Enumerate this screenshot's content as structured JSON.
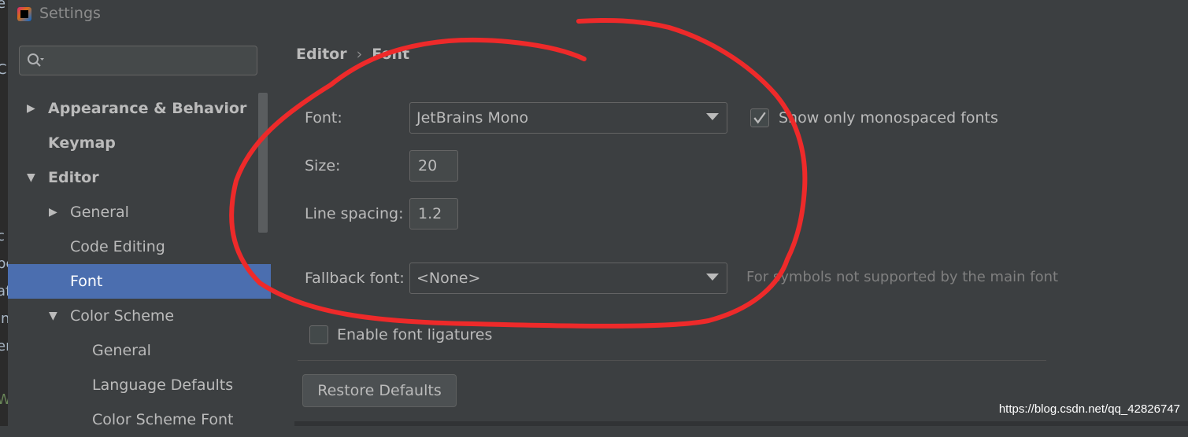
{
  "window": {
    "title": "Settings"
  },
  "edge_glyphs": [
    "e",
    "C",
    "c",
    "pe",
    "af",
    "in",
    "er",
    "W"
  ],
  "sidebar": {
    "search_placeholder": "",
    "items": [
      {
        "label": "Appearance & Behavior",
        "arrow": "right",
        "bold": true
      },
      {
        "label": "Keymap",
        "arrow": "",
        "bold": true
      },
      {
        "label": "Editor",
        "arrow": "down",
        "bold": true
      },
      {
        "label": "General",
        "arrow": "right",
        "bold": false
      },
      {
        "label": "Code Editing",
        "arrow": "",
        "bold": false
      },
      {
        "label": "Font",
        "arrow": "",
        "bold": false,
        "selected": true
      },
      {
        "label": "Color Scheme",
        "arrow": "down",
        "bold": false
      },
      {
        "label": "General",
        "arrow": "",
        "bold": false
      },
      {
        "label": "Language Defaults",
        "arrow": "",
        "bold": false
      },
      {
        "label": "Color Scheme Font",
        "arrow": "",
        "bold": false
      }
    ]
  },
  "breadcrumb": {
    "parent": "Editor",
    "separator": "›",
    "current": "Font"
  },
  "font_settings": {
    "font_label": "Font:",
    "font_value": "JetBrains Mono",
    "monospaced_label": "Show only monospaced fonts",
    "monospaced_checked": true,
    "size_label": "Size:",
    "size_value": "20",
    "line_spacing_label": "Line spacing:",
    "line_spacing_value": "1.2",
    "fallback_label": "Fallback font:",
    "fallback_value": "<None>",
    "fallback_hint": "For symbols not supported by the main font",
    "ligatures_label": "Enable font ligatures",
    "ligatures_checked": false,
    "restore_label": "Restore Defaults"
  },
  "watermark": "https://blog.csdn.net/qq_42826747",
  "colors": {
    "selection": "#4b6eaf",
    "background": "#3c3f41",
    "annotation": "#ee2a2a"
  }
}
